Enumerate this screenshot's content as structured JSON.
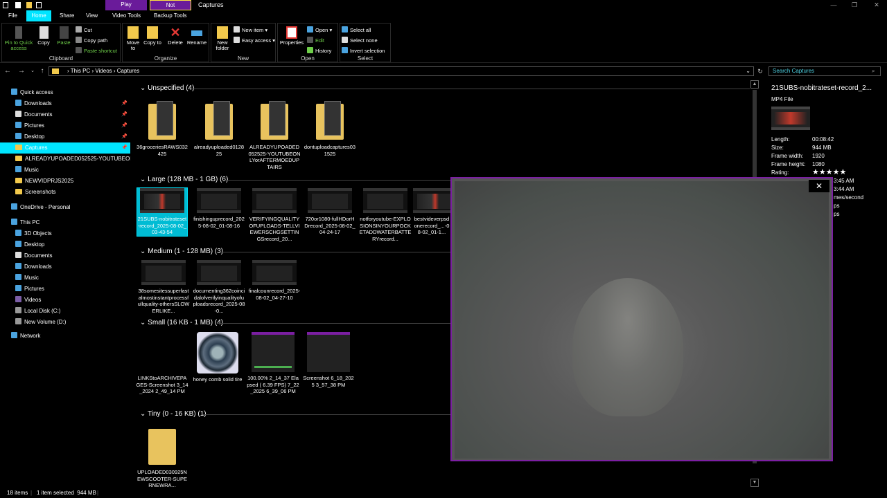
{
  "titlebar": {
    "play_label": "Play",
    "not_backed_up_label": "Not backed up",
    "title": "Captures",
    "minimize": "—",
    "maximize": "❐",
    "close": "✕"
  },
  "tabs": [
    "File",
    "Home",
    "Share",
    "View",
    "Video Tools",
    "Backup Tools"
  ],
  "ribbon": {
    "clipboard": {
      "label": "Clipboard",
      "pin": "Pin to Quick access",
      "copy": "Copy",
      "paste": "Paste",
      "cut": "Cut",
      "copy_path": "Copy path",
      "paste_shortcut": "Paste shortcut"
    },
    "organize": {
      "label": "Organize",
      "move_to": "Move to",
      "copy_to": "Copy to",
      "delete": "Delete",
      "rename": "Rename"
    },
    "new": {
      "label": "New",
      "new_folder": "New folder",
      "new_item": "New item",
      "easy_access": "Easy access"
    },
    "open": {
      "label": "Open",
      "properties": "Properties",
      "open": "Open",
      "edit": "Edit",
      "history": "History"
    },
    "select": {
      "label": "Select",
      "select_all": "Select all",
      "select_none": "Select none",
      "invert": "Invert selection"
    }
  },
  "address": {
    "path": [
      "This PC",
      "Videos",
      "Captures"
    ],
    "search_placeholder": "Search Captures"
  },
  "nav": {
    "quick_access": "Quick access",
    "quick_items": [
      "Downloads",
      "Documents",
      "Pictures",
      "Desktop",
      "Captures",
      "ALREADYUPOADED052525-YOUTUBEONLYorAFTER",
      "Music",
      "NEWVIDPRJS2025",
      "Screenshots"
    ],
    "onedrive": "OneDrive - Personal",
    "this_pc": "This PC",
    "pc_items": [
      "3D Objects",
      "Desktop",
      "Documents",
      "Downloads",
      "Music",
      "Pictures",
      "Videos",
      "Local Disk (C:)",
      "New Volume (D:)"
    ],
    "network": "Network"
  },
  "groups": {
    "unspecified": {
      "header": "Unspecified (4)",
      "items": [
        "36groceriesRAWS032425",
        "alreadyuploaded012825",
        "ALREADYUPOADED052525-YOUTUBEONLYorAFTERMOEDUPTAIRS",
        "dontuploadcaptures031525"
      ]
    },
    "large": {
      "header": "Large (128 MB - 1 GB) (6)",
      "items": [
        "21SUBS-nobitrateset-record_2025-08-02_03-43-54",
        "finishinguprecord_2025-08-02_01-08-16",
        "VERIFYINGQUALITYOFUPLOADS-TELLVIEWERSCHGSETTINGSrecord_20...",
        "720or1080-fullHDorHDrecord_2025-08-02_04-24-17",
        "notforyoutube-EXPLOSIONSINYOURPOCKETADDWATERBATTERYrecord...",
        "bestvideverpsdonerecord_...-08-02_01-1..."
      ]
    },
    "medium": {
      "header": "Medium (1 - 128 MB) (3)",
      "items": [
        "38somesitessuperfastalmostinstantprocessfullquality-othersSLOWERLIKE...",
        "documenting362coincidalofverifyinqualityofuploadsrecord_2025-08-0...",
        "finalcounrecord_2025-08-02_04-27-10"
      ]
    },
    "small": {
      "header": "Small (16 KB - 1 MB) (4)",
      "items": [
        "LINKStoARCHIVEPAGES-Screenshot 3_14_2024 2_49_14 PM",
        "honey comb solid tire",
        "100.00% 2_14_37 Elapsed ( 6.39 FPS) 7_22_2025 6_39_06 PM",
        "Screenshot 6_18_2025 3_57_38 PM"
      ]
    },
    "tiny": {
      "header": "Tiny (0 - 16 KB) (1)",
      "items": [
        "UPLOADED030925NEWSCOOTER-SUPERNEWRA..."
      ]
    }
  },
  "details": {
    "name": "21SUBS-nobitrateset-record_2...",
    "type": "MP4 File",
    "rows": [
      {
        "label": "Length:",
        "value": "00:08:42"
      },
      {
        "label": "Size:",
        "value": "944 MB"
      },
      {
        "label": "Frame width:",
        "value": "1920"
      },
      {
        "label": "Frame height:",
        "value": "1080"
      },
      {
        "label": "Rating:",
        "value": "★★★★★"
      }
    ],
    "partial": [
      "3:45 AM",
      "3:44 AM",
      "mes/second",
      "ps",
      "ps"
    ]
  },
  "popup": {
    "close": "✕"
  },
  "status": {
    "items": "18 items",
    "selected": "1 item selected  944 MB"
  },
  "colors": {
    "accent": "#00e5ff",
    "context_tab": "#6a1b9a",
    "green_text": "#6fcf4a",
    "folder": "#e8c35e"
  }
}
